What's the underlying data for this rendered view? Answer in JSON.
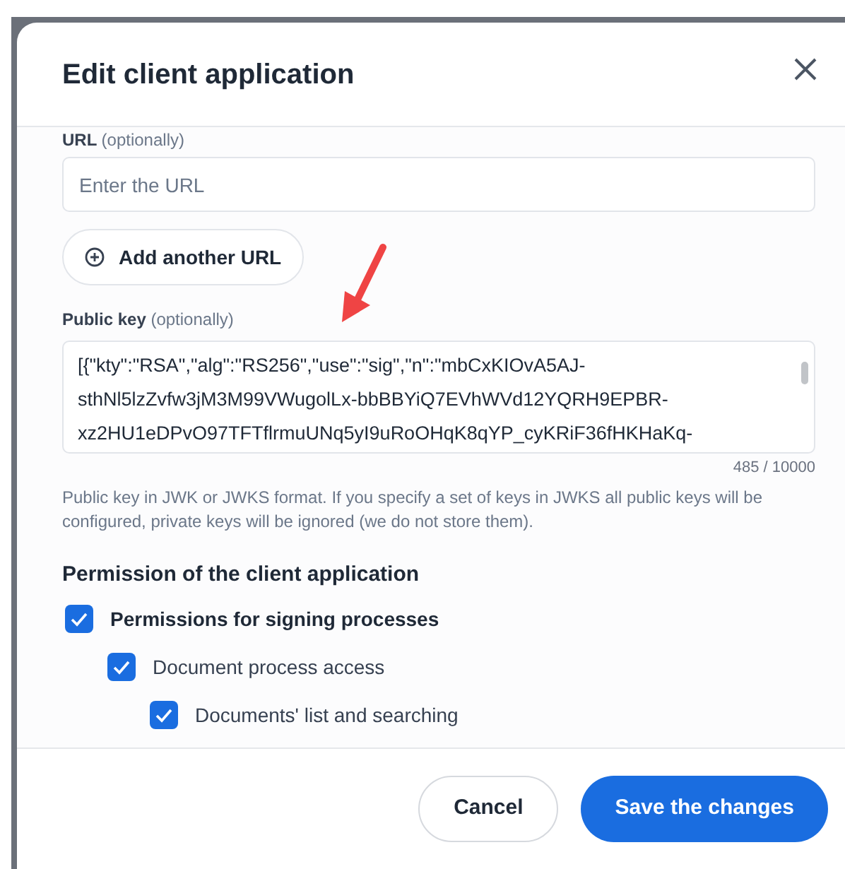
{
  "dialog": {
    "title": "Edit client application"
  },
  "url_field": {
    "label": "URL",
    "hint": "(optionally)",
    "placeholder": "Enter the URL"
  },
  "add_url_button": {
    "label": "Add another URL"
  },
  "public_key": {
    "label": "Public key",
    "hint": "(optionally)",
    "value": "[{\"kty\":\"RSA\",\"alg\":\"RS256\",\"use\":\"sig\",\"n\":\"mbCxKIOvA5AJ-sthNl5lzZvfw3jM3M99VWugolLx-bbBBYiQ7EVhWVd12YQRH9EPBR-xz2HU1eDPvO97TFTflrmuUNq5yI9uRoOHqK8qYP_cyKRiF36fHKHaKq-",
    "counter": "485 / 10000",
    "help": "Public key in JWK or JWKS format. If you specify a set of keys in JWKS all public keys will be configured, private keys will be ignored (we do not store them)."
  },
  "permissions": {
    "heading": "Permission of the client application",
    "items": [
      {
        "label": "Permissions for signing processes",
        "checked": true,
        "children": [
          {
            "label": "Document process access",
            "checked": true,
            "children": [
              {
                "label": "Documents' list and searching",
                "checked": true
              }
            ]
          }
        ]
      }
    ]
  },
  "buttons": [
    {
      "label": "Cancel",
      "kind": "secondary"
    },
    {
      "label": "Save the changes",
      "kind": "primary"
    }
  ]
}
